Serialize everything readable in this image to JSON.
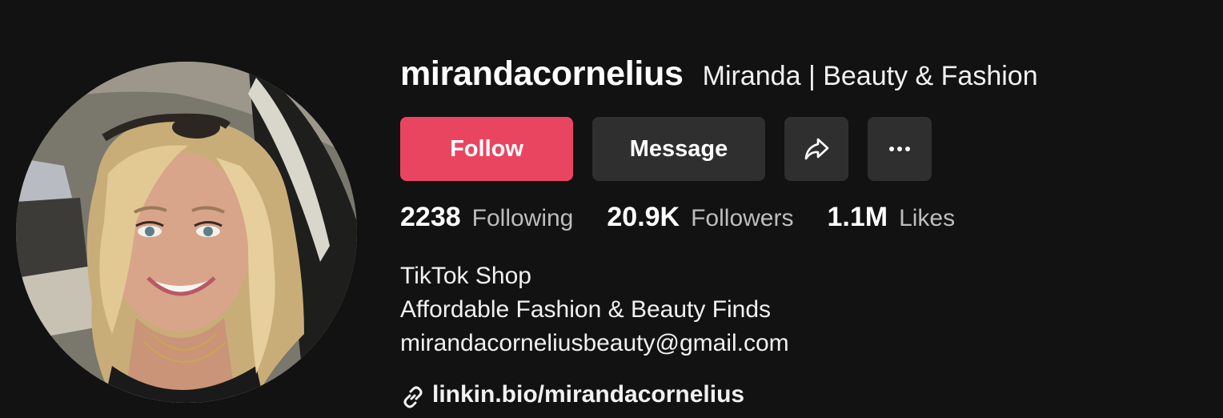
{
  "profile": {
    "username": "mirandacornelius",
    "nickname": "Miranda | Beauty & Fashion",
    "avatar_alt": "profile photo"
  },
  "actions": {
    "follow_label": "Follow",
    "message_label": "Message",
    "share_icon": "share-arrow-icon",
    "more_icon": "ellipsis-icon"
  },
  "stats": [
    {
      "value": "2238",
      "label": "Following"
    },
    {
      "value": "20.9K",
      "label": "Followers"
    },
    {
      "value": "1.1M",
      "label": "Likes"
    }
  ],
  "bio": {
    "lines": [
      "TikTok Shop",
      "Affordable Fashion & Beauty Finds",
      "mirandacorneliusbeauty@gmail.com"
    ]
  },
  "link": {
    "icon": "link-icon",
    "text": "linkin.bio/mirandacornelius"
  },
  "colors": {
    "background": "#121212",
    "follow_button": "#ea4560",
    "secondary_button": "#2f2f2f",
    "muted_text": "#bdbdbd"
  }
}
